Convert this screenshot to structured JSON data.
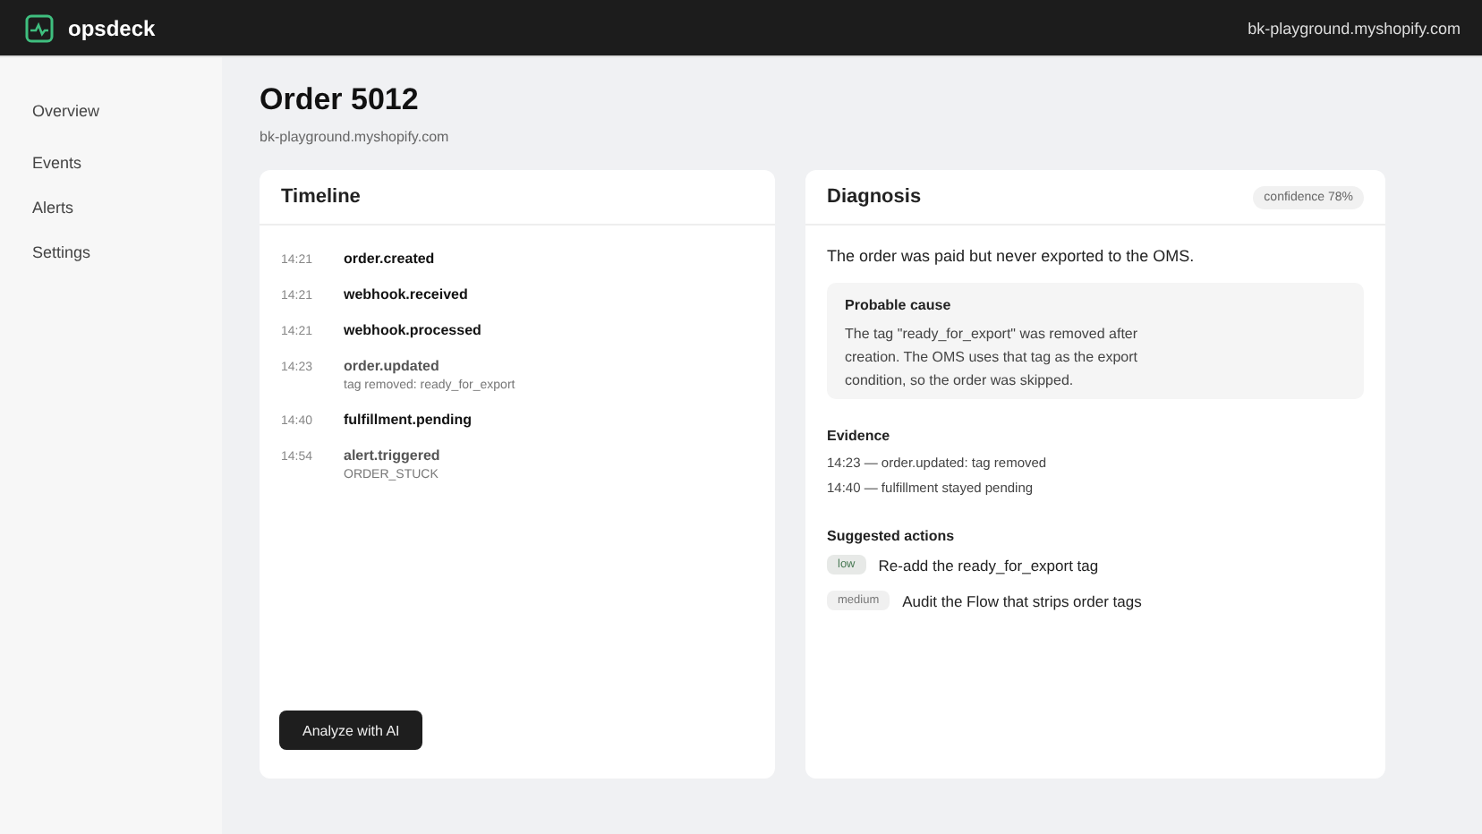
{
  "brand": {
    "name": "opsdeck"
  },
  "store": "bk-playground.myshopify.com",
  "sidebar": {
    "items": [
      {
        "label": "Overview",
        "selected": false
      },
      {
        "label": "Events",
        "selected": false
      },
      {
        "label": "Alerts",
        "selected": false
      },
      {
        "label": "Settings",
        "selected": false
      }
    ]
  },
  "page": {
    "title": "Order 5012",
    "subtitle": "bk-playground.myshopify.com"
  },
  "timeline": {
    "title": "Timeline",
    "events": [
      {
        "time": "14:21",
        "name": "order.created",
        "emphasis": true
      },
      {
        "time": "14:21",
        "name": "webhook.received",
        "emphasis": true
      },
      {
        "time": "14:21",
        "name": "webhook.processed",
        "emphasis": true
      },
      {
        "time": "14:23",
        "name": "order.updated",
        "detail": "tag removed: ready_for_export",
        "emphasis": false
      },
      {
        "time": "14:40",
        "name": "fulfillment.pending",
        "emphasis": true
      },
      {
        "time": "14:54",
        "name": "alert.triggered",
        "detail": "ORDER_STUCK",
        "emphasis": false
      }
    ],
    "button": "Analyze with AI"
  },
  "diagnosis": {
    "title": "Diagnosis",
    "confidence": "confidence 78%",
    "summary": "The order was paid but never exported to the OMS.",
    "cause": {
      "title": "Probable cause",
      "text": "The tag \"ready_for_export\" was removed after creation. The OMS uses that tag as the export condition, so the order was skipped."
    },
    "evidence": {
      "title": "Evidence",
      "items": [
        "14:23 — order.updated: tag removed",
        "14:40 — fulfillment stayed pending"
      ]
    },
    "actions": {
      "title": "Suggested actions",
      "items": [
        {
          "priority": "low",
          "kind": "low",
          "text": "Re-add the ready_for_export tag"
        },
        {
          "priority": "medium",
          "kind": "medium",
          "text": "Audit the Flow that strips order tags"
        }
      ]
    }
  }
}
